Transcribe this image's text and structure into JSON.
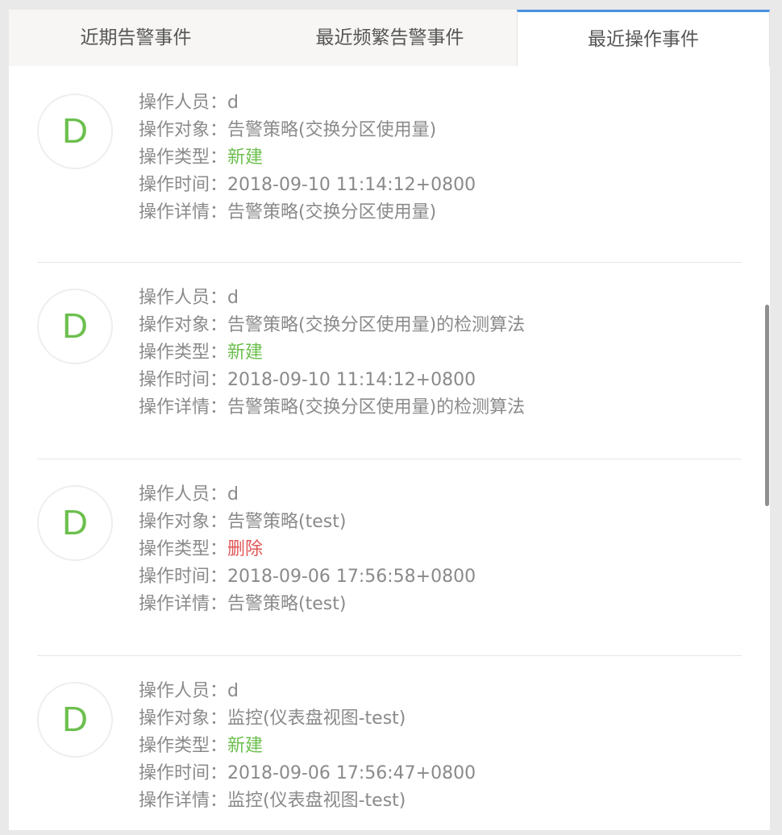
{
  "tabs": [
    {
      "label": "近期告警事件"
    },
    {
      "label": "最近频繁告警事件"
    },
    {
      "label": "最近操作事件"
    }
  ],
  "field_labels": {
    "operator": "操作人员：",
    "target": "操作对象：",
    "type": "操作类型：",
    "time": "操作时间：",
    "detail": "操作详情："
  },
  "events": [
    {
      "avatar": "D",
      "operator": "d",
      "target": "告警策略(交换分区使用量)",
      "type": "新建",
      "type_color": "#6cbf4e",
      "time": "2018-09-10 11:14:12+0800",
      "detail": "告警策略(交换分区使用量)"
    },
    {
      "avatar": "D",
      "operator": "d",
      "target": "告警策略(交换分区使用量)的检测算法",
      "type": "新建",
      "type_color": "#6cbf4e",
      "time": "2018-09-10 11:14:12+0800",
      "detail": "告警策略(交换分区使用量)的检测算法"
    },
    {
      "avatar": "D",
      "operator": "d",
      "target": "告警策略(test)",
      "type": "删除",
      "type_color": "#e05555",
      "time": "2018-09-06 17:56:58+0800",
      "detail": "告警策略(test)"
    },
    {
      "avatar": "D",
      "operator": "d",
      "target": "监控(仪表盘视图-test)",
      "type": "新建",
      "type_color": "#6cbf4e",
      "time": "2018-09-06 17:56:47+0800",
      "detail": "监控(仪表盘视图-test)"
    }
  ]
}
